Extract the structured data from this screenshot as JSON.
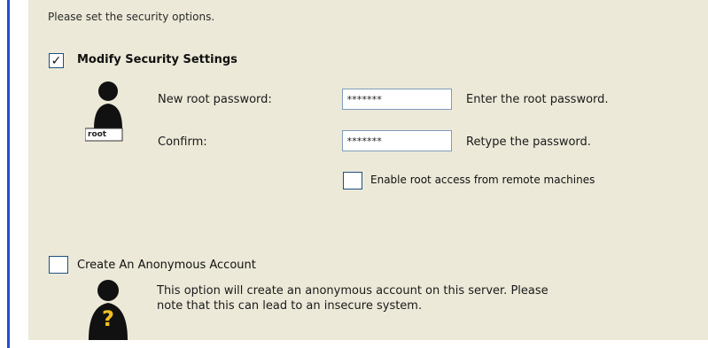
{
  "intro_text": "Please set the security options.",
  "security": {
    "modify_checkbox_mark": "✓",
    "modify_label": "Modify Security Settings",
    "root_icon_badge": "root",
    "new_password_label": "New root password:",
    "new_password_value": "*******",
    "new_password_hint": "Enter the root password.",
    "confirm_label": "Confirm:",
    "confirm_value": "*******",
    "confirm_hint": "Retype the password.",
    "remote_access_label": "Enable root access from remote machines"
  },
  "anonymous": {
    "label": "Create An Anonymous Account",
    "icon_symbol": "?",
    "description_line1": "This option will create an anonymous account on this server. Please",
    "description_line2": "note that this can lead to an insecure system."
  },
  "colors": {
    "panel_bg": "#ece9d8",
    "accent_border": "#1f4fd0",
    "question_mark": "#f0c020"
  }
}
